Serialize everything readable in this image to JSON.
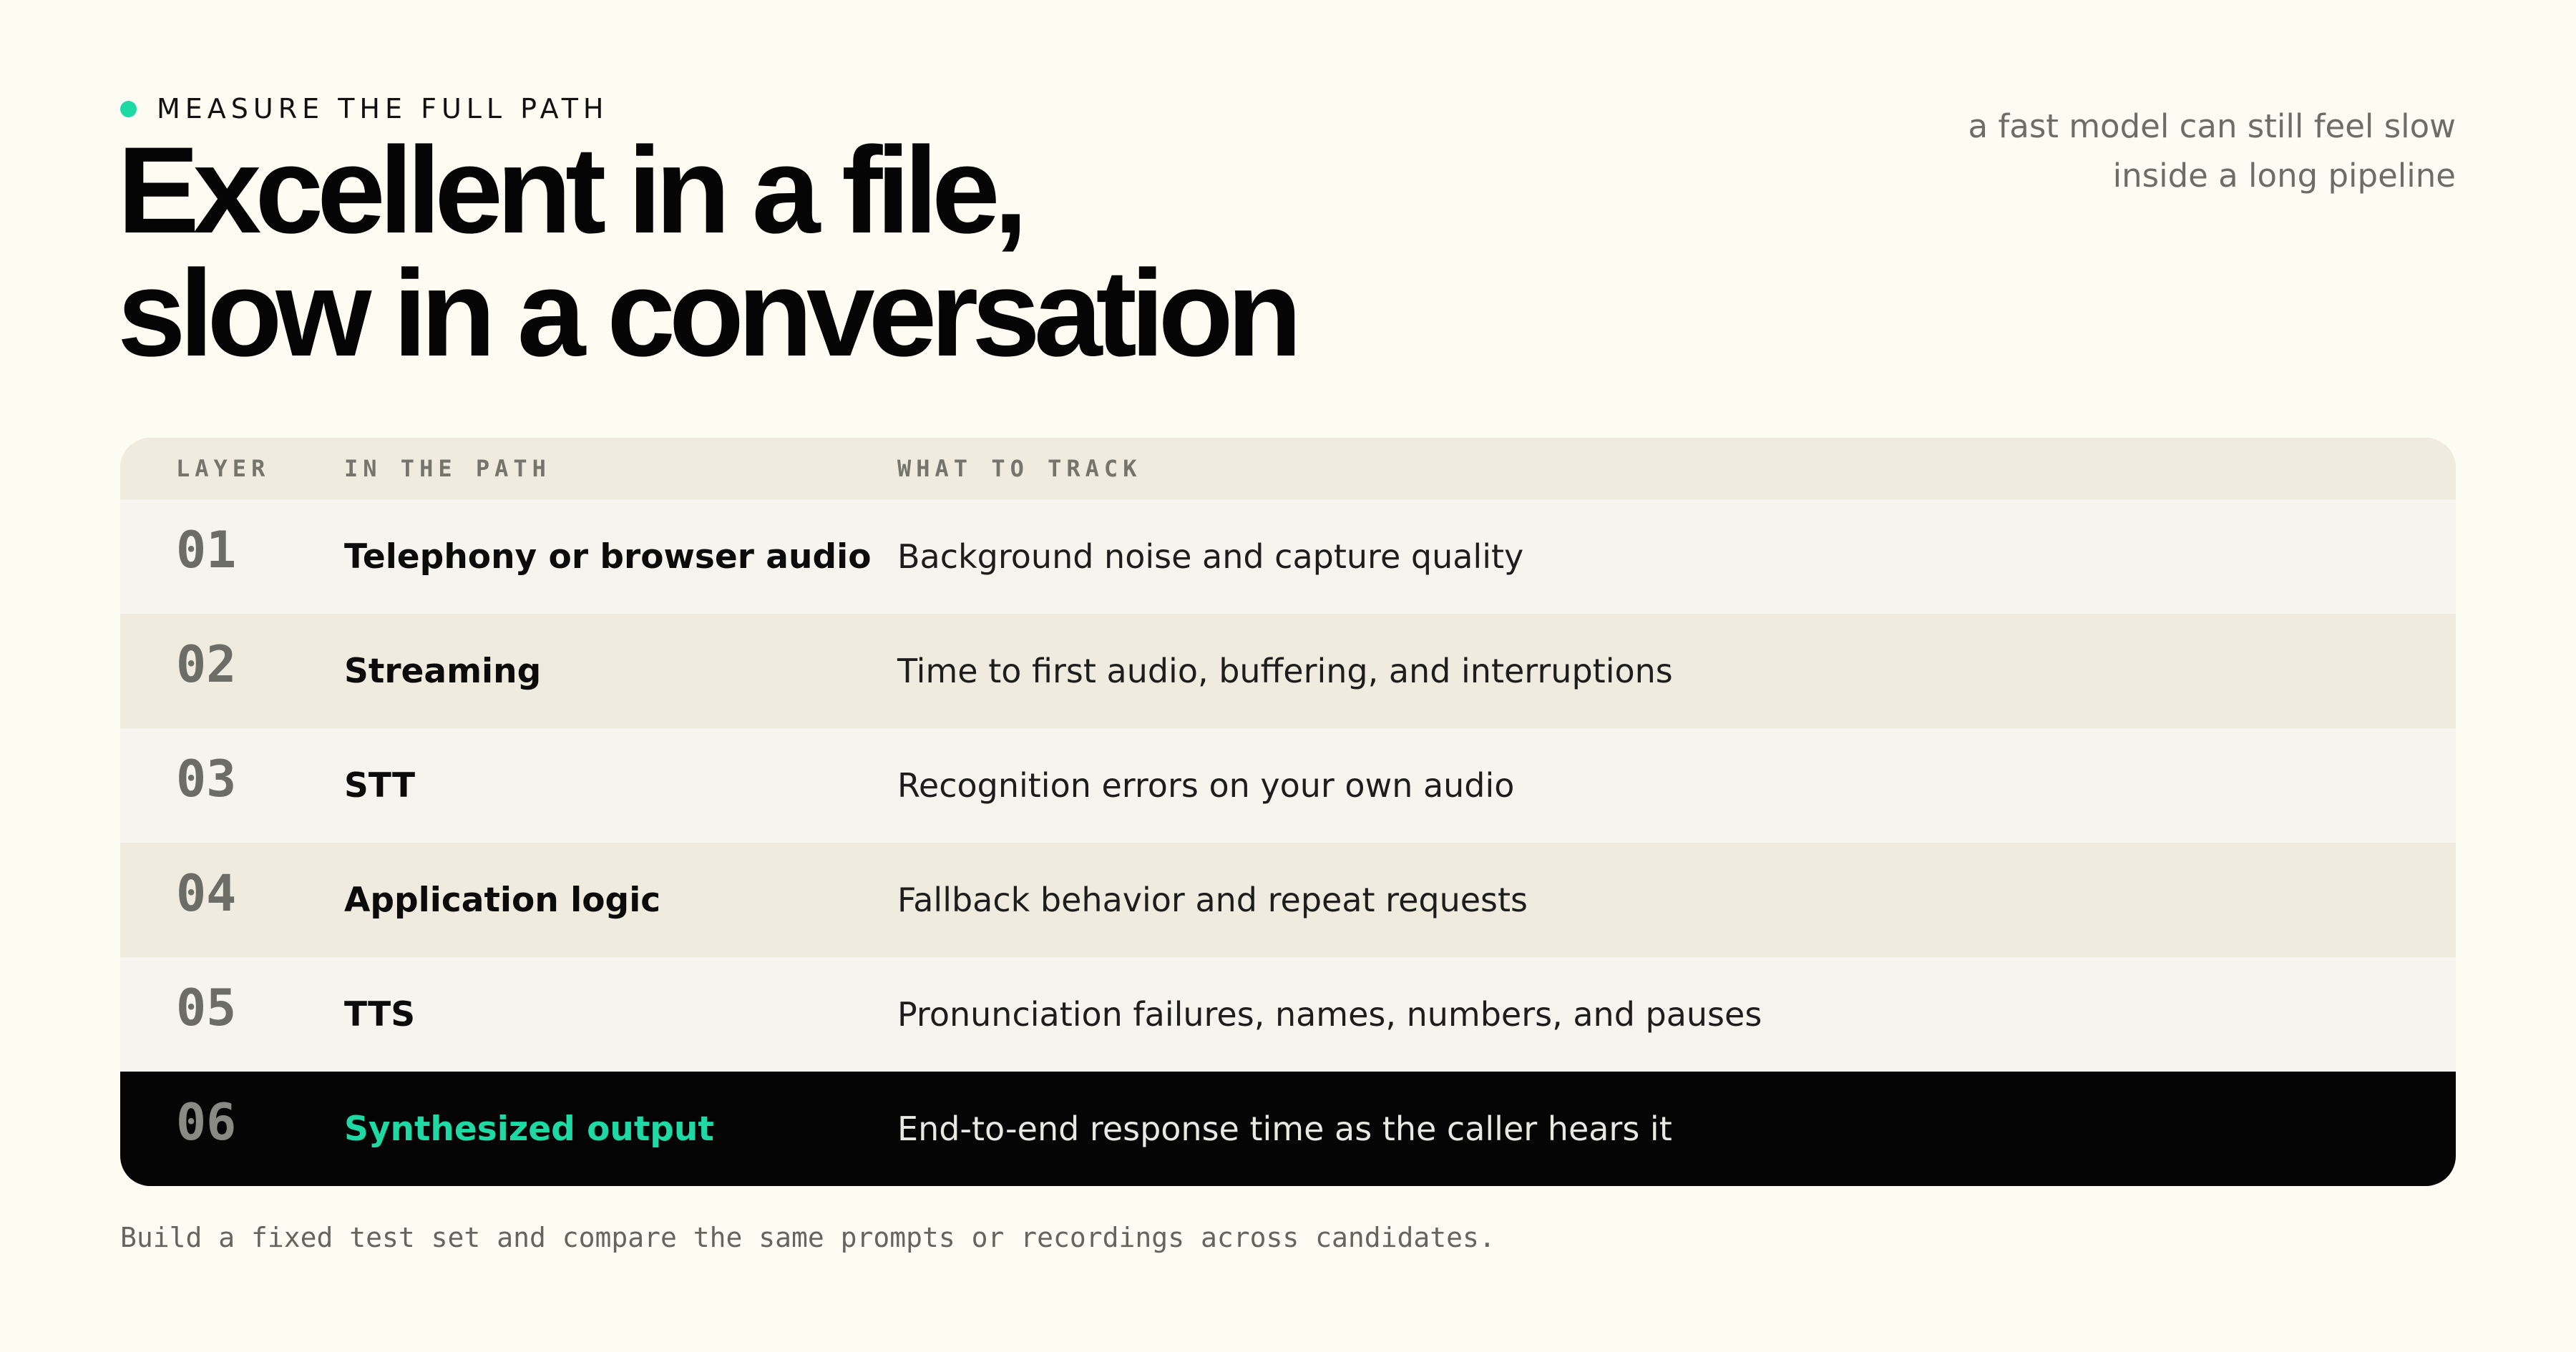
{
  "eyebrow": {
    "label": "MEASURE THE FULL PATH",
    "dot_color": "#1fd9a5"
  },
  "headline": {
    "line1": "Excellent in a file,",
    "line2": "slow in a conversation"
  },
  "aside": {
    "line1": "a fast model can still feel slow",
    "line2": "inside a long pipeline"
  },
  "table": {
    "headers": {
      "layer": "LAYER",
      "path": "IN THE PATH",
      "track": "WHAT TO TRACK"
    },
    "rows": [
      {
        "number": "01",
        "layer": "Telephony or browser audio",
        "track": "Background noise and capture quality"
      },
      {
        "number": "02",
        "layer": "Streaming",
        "track": "Time to first audio, buffering, and interruptions"
      },
      {
        "number": "03",
        "layer": "STT",
        "track": "Recognition errors on your own audio"
      },
      {
        "number": "04",
        "layer": "Application logic",
        "track": "Fallback behavior and repeat requests"
      },
      {
        "number": "05",
        "layer": "TTS",
        "track": "Pronunciation failures, names, numbers, and pauses"
      },
      {
        "number": "06",
        "layer": "Synthesized output",
        "track": "End-to-end response time as the caller hears it"
      }
    ],
    "accent_color": "#1fd9a5",
    "highlight_row_color": "#050505"
  },
  "footnote": "Build a fixed test set and compare the same prompts or recordings across candidates."
}
